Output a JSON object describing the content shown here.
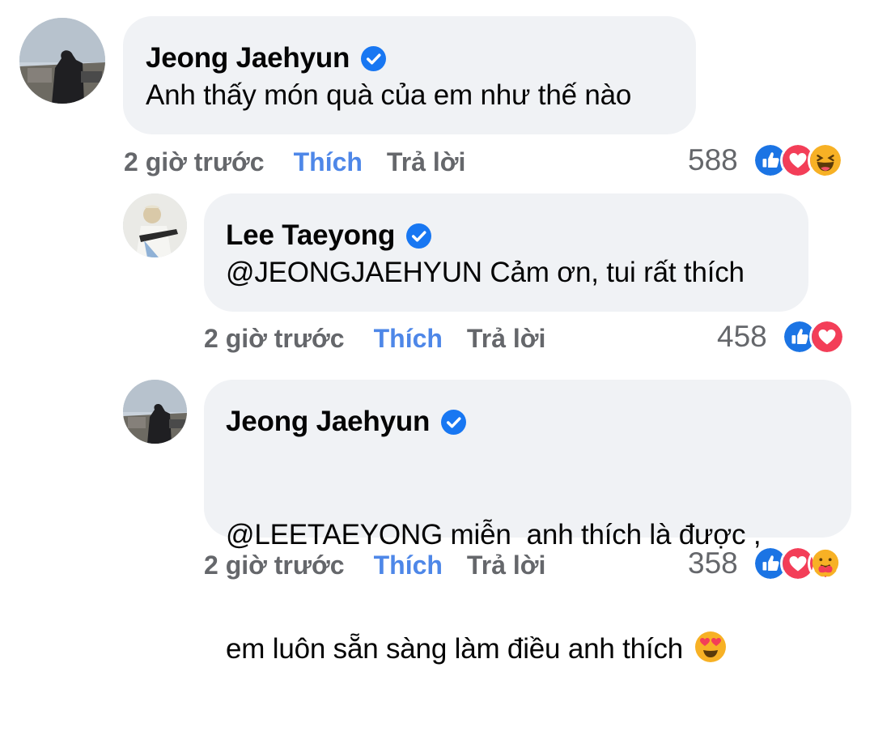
{
  "colors": {
    "bubble": "#f0f2f5",
    "like_blue": "#4e87e8",
    "meta_gray": "#65676b",
    "verified": "#1877f2",
    "love_red": "#f33e58",
    "haha_yellow": "#f7b125"
  },
  "comments": [
    {
      "author": "Jeong Jaehyun",
      "text": "Anh thấy món quà của em như thế nào",
      "time": "2 giờ trước",
      "like_label": "Thích",
      "reply_label": "Trả lời",
      "reaction_count": "588",
      "reactions": [
        "like-icon",
        "love-icon",
        "haha-icon"
      ]
    },
    {
      "author": "Lee Taeyong",
      "text": "@JEONGJAEHYUN Cảm ơn, tui rất thích",
      "time": "2 giờ trước",
      "like_label": "Thích",
      "reply_label": "Trả lời",
      "reaction_count": "458",
      "reactions": [
        "like-icon",
        "love-icon"
      ]
    },
    {
      "author": "Jeong Jaehyun",
      "text_line1": "@LEETAEYONG miễn  anh thích là được ,",
      "text_line2": "em luôn sẵn sàng làm điều anh thích",
      "time": "2 giờ trước",
      "like_label": "Thích",
      "reply_label": "Trả lời",
      "reaction_count": "358",
      "reactions": [
        "like-icon",
        "love-icon",
        "care-icon"
      ]
    }
  ]
}
